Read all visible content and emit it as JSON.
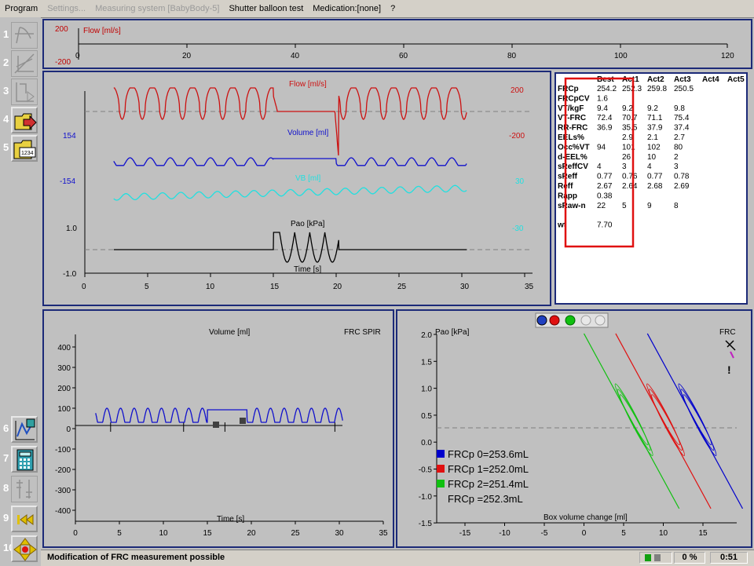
{
  "menu": {
    "items": [
      {
        "label": "Program",
        "disabled": false
      },
      {
        "label": "Settings...",
        "disabled": true
      },
      {
        "label": "Measuring system [BabyBody-5]",
        "disabled": true
      },
      {
        "label": "Shutter balloon test",
        "disabled": false
      },
      {
        "label": "Medication:[none]",
        "disabled": false
      },
      {
        "label": "?",
        "disabled": false
      }
    ]
  },
  "toolbar": {
    "buttons": [
      {
        "num": "1",
        "icon": "flow-volume-icon",
        "enabled": false
      },
      {
        "num": "2",
        "icon": "curve-select-icon",
        "enabled": false
      },
      {
        "num": "3",
        "icon": "play-trace-icon",
        "enabled": false
      },
      {
        "num": "4",
        "icon": "folder-open-icon",
        "enabled": true
      },
      {
        "num": "5",
        "icon": "folder-numbers-icon",
        "enabled": true
      },
      {
        "num": "6",
        "icon": "measure-chart-icon",
        "enabled": true
      },
      {
        "num": "7",
        "icon": "calculator-icon",
        "enabled": true
      },
      {
        "num": "8",
        "icon": "sort-values-icon",
        "enabled": false
      },
      {
        "num": "9",
        "icon": "skip-back-icon",
        "enabled": true
      },
      {
        "num": "10",
        "icon": "arrows-center-icon",
        "enabled": true
      }
    ],
    "folder_digits": "1234"
  },
  "top_strip": {
    "label": "Flow [ml/s]",
    "yticks": [
      "200",
      "-200"
    ],
    "xticks": [
      "0",
      "20",
      "40",
      "60",
      "80",
      "100",
      "120"
    ]
  },
  "main_chart": {
    "flow_label": "Flow [ml/s]",
    "volume_label": "Volume [ml]",
    "vb_label": "VB [ml]",
    "pao_label": "Pao [kPa]",
    "time_label": "Time [s]",
    "left_ticks": [
      "154",
      "-154",
      "1.0",
      "-1.0"
    ],
    "right_ticks": [
      "200",
      "-200",
      "30",
      "-30"
    ],
    "xticks": [
      "0",
      "5",
      "10",
      "15",
      "20",
      "25",
      "30",
      "35"
    ]
  },
  "results_table": {
    "headers": [
      "",
      "Best",
      "Act1",
      "Act2",
      "Act3",
      "Act4",
      "Act5"
    ],
    "rows": [
      [
        "FRCp",
        "254.2",
        "252.3",
        "259.8",
        "250.5",
        "",
        ""
      ],
      [
        "FRCpCV",
        "1.6",
        "",
        "",
        "",
        "",
        ""
      ],
      [
        "VT/kgF",
        "9.4",
        "9.2",
        "9.2",
        "9.8",
        "",
        ""
      ],
      [
        "VT-FRC",
        "72.4",
        "70.7",
        "71.1",
        "75.4",
        "",
        ""
      ],
      [
        "RR-FRC",
        "36.9",
        "35.5",
        "37.9",
        "37.4",
        "",
        ""
      ],
      [
        "EELs%",
        "",
        "2.9",
        "2.1",
        "2.7",
        "",
        ""
      ],
      [
        "Occ%VT",
        "94",
        "101",
        "102",
        "80",
        "",
        ""
      ],
      [
        "d-EEL%",
        "",
        "26",
        "10",
        "2",
        "",
        ""
      ],
      [
        "sReffCV",
        "4",
        "3",
        "4",
        "3",
        "",
        ""
      ],
      [
        "sReff",
        "0.77",
        "0.76",
        "0.77",
        "0.78",
        "",
        ""
      ],
      [
        "Reff",
        "2.67",
        "2.64",
        "2.68",
        "2.69",
        "",
        ""
      ],
      [
        "Rapp",
        "0.38",
        "",
        "",
        "",
        "",
        ""
      ],
      [
        "sRaw-n",
        "22",
        "5",
        "9",
        "8",
        "",
        ""
      ],
      [
        "",
        "",
        "",
        "",
        "",
        "",
        ""
      ],
      [
        "wt",
        "7.70",
        "",
        "",
        "",
        "",
        ""
      ]
    ],
    "highlight_color": "#e01010"
  },
  "volume_chart": {
    "title": "Volume [ml]",
    "mode": "FRC SPIR",
    "yticks": [
      "400",
      "300",
      "200",
      "100",
      "0",
      "-100",
      "-200",
      "-300",
      "-400"
    ],
    "xticks": [
      "0",
      "5",
      "10",
      "15",
      "20",
      "25",
      "30",
      "35"
    ],
    "xlabel": "Time [s]"
  },
  "pao_chart": {
    "ylabel": "Pao [kPa]",
    "xlabel": "Box volume change [ml]",
    "corner_label": "FRC",
    "yticks": [
      "2.0",
      "1.5",
      "1.0",
      "0.5",
      "0.0",
      "-0.5",
      "-1.0",
      "-1.5"
    ],
    "xticks": [
      "-15",
      "-10",
      "-5",
      "0",
      "5",
      "10",
      "15"
    ],
    "legend": [
      {
        "text": "FRCp 0=253.6mL",
        "color": "#0000cc"
      },
      {
        "text": "FRCp 1=252.0mL",
        "color": "#e01010"
      },
      {
        "text": "FRCp 2=251.4mL",
        "color": "#10c010"
      },
      {
        "text": "FRCp  =252.3mL",
        "color": ""
      }
    ],
    "exclaim": "!"
  },
  "status": {
    "message": "Modification of FRC measurement possible",
    "percent": "0 %",
    "time": "0:51"
  }
}
